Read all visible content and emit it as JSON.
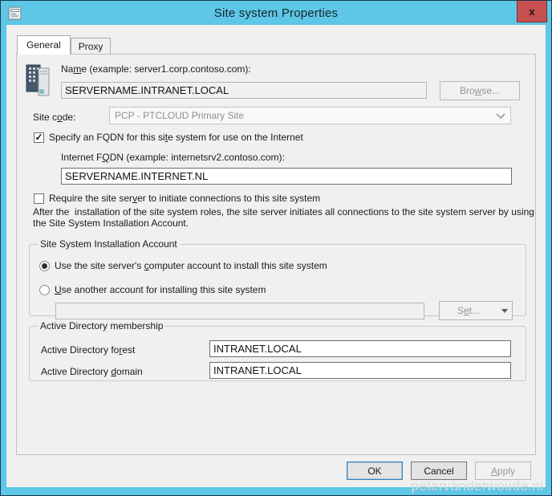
{
  "window": {
    "title": "Site system Properties",
    "close_glyph": "x",
    "watermark": "petervanderwoude.nl",
    "colors": {
      "titlebar": "#5EC6E6",
      "frame_border": "#1B3A4E",
      "close_button": "#C75050",
      "dialog_bg": "#F0F0F0",
      "ok_border": "#3C7FB1"
    }
  },
  "tabs": {
    "general": "General",
    "proxy": "Proxy"
  },
  "form": {
    "name_label": {
      "pre": "Na",
      "mn": "m",
      "post": "e (example: server1.corp.contoso.com):"
    },
    "name_value": "SERVERNAME.INTRANET.LOCAL",
    "browse_button": {
      "pre": "Bro",
      "mn": "w",
      "post": "se..."
    },
    "site_code_label": {
      "pre": "Site c",
      "mn": "o",
      "post": "de:"
    },
    "site_code_value": "PCP - PTCLOUD Primary Site",
    "fqdn_checkbox": {
      "checked": true,
      "glyph": "✓",
      "label": {
        "pre": "Specify an FQDN for this si",
        "mn": "t",
        "post": "e system for use on the Internet"
      }
    },
    "internet_fqdn_label": {
      "pre": "Internet F",
      "mn": "Q",
      "post": "DN (example: internetsrv2.contoso.com):"
    },
    "internet_fqdn_value": "SERVERNAME.INTERNET.NL",
    "require_checkbox": {
      "checked": false,
      "glyph": "",
      "label": {
        "pre": "Require the site ser",
        "mn": "v",
        "post": "er to initiate connections to this site system"
      }
    },
    "info_text": "After the  installation of the site system roles, the site server initiates all connections to the site system server by using the Site System Installation Account.",
    "install_group": {
      "legend": "Site System Installation Account",
      "radio_computer": {
        "selected": true,
        "label": {
          "pre": "Use the site server's ",
          "mn": "c",
          "post": "omputer account to install this site system"
        }
      },
      "radio_another": {
        "selected": false,
        "label": {
          "pre": "",
          "mn": "U",
          "post": "se another account for installing this site system"
        }
      },
      "account_value": "",
      "set_button": {
        "pre": "S",
        "mn": "e",
        "post": "t..."
      }
    },
    "ad_group": {
      "legend": "Active Directory membership",
      "forest_label": {
        "pre": "Active Directory fo",
        "mn": "r",
        "post": "est"
      },
      "forest_value": "INTRANET.LOCAL",
      "domain_label": {
        "pre": "Active Directory ",
        "mn": "d",
        "post": "omain"
      },
      "domain_value": "INTRANET.LOCAL"
    }
  },
  "footer": {
    "ok": "OK",
    "cancel": "Cancel",
    "apply": {
      "pre": "",
      "mn": "A",
      "post": "pply"
    }
  }
}
